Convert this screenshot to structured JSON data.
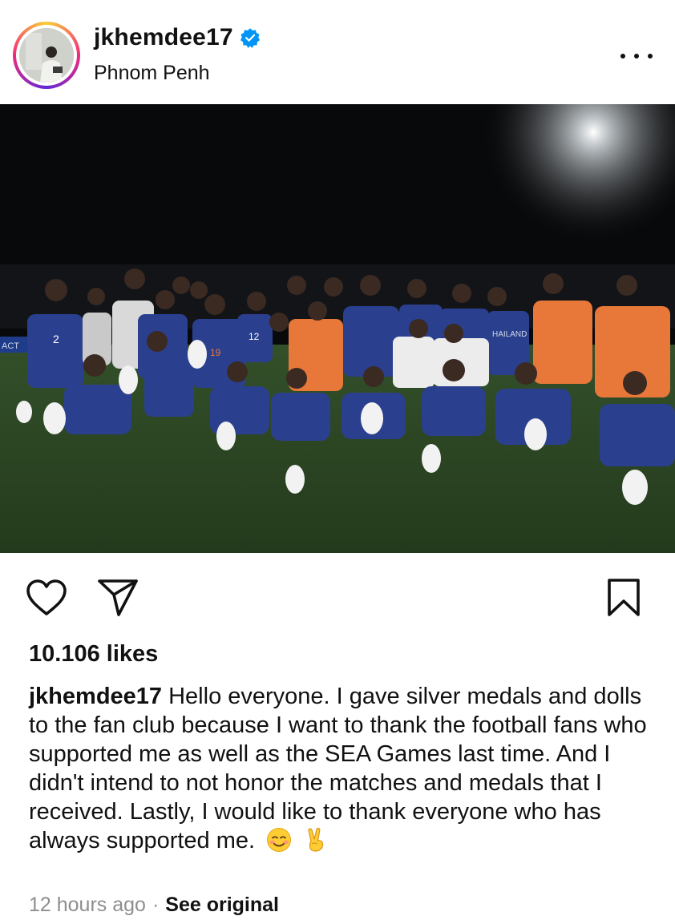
{
  "post": {
    "username": "jkhemdee17",
    "location": "Phnom Penh",
    "likes": "10.106 likes",
    "caption_user": "jkhemdee17",
    "caption_text": "Hello everyone. I gave silver medals and dolls to the fan club because I want to thank the football fans who supported me as well as the SEA Games last time. And I didn't intend to not honor the matches and medals that I received. Lastly, I would like to thank everyone who has always supported me.",
    "timestamp": "12 hours ago",
    "separator": "·",
    "see_original": "See original"
  },
  "photo": {
    "badge_text": "ACT",
    "jersey_text": "HAILAND",
    "jersey_numbers": [
      "2",
      "19",
      "12"
    ]
  },
  "icons": {
    "verified": "verified-badge-icon",
    "more": "more-options-icon",
    "like": "heart-icon",
    "share": "send-icon",
    "save": "bookmark-icon",
    "emoji_1": "smiling-face-icon",
    "emoji_2": "victory-hand-icon"
  },
  "colors": {
    "verified_blue": "#0095f6",
    "text": "#111111",
    "muted": "#8e8e8e",
    "grass": "#2f4a22",
    "jersey_blue": "#2b3f8f",
    "staff_orange": "#e8773a"
  }
}
